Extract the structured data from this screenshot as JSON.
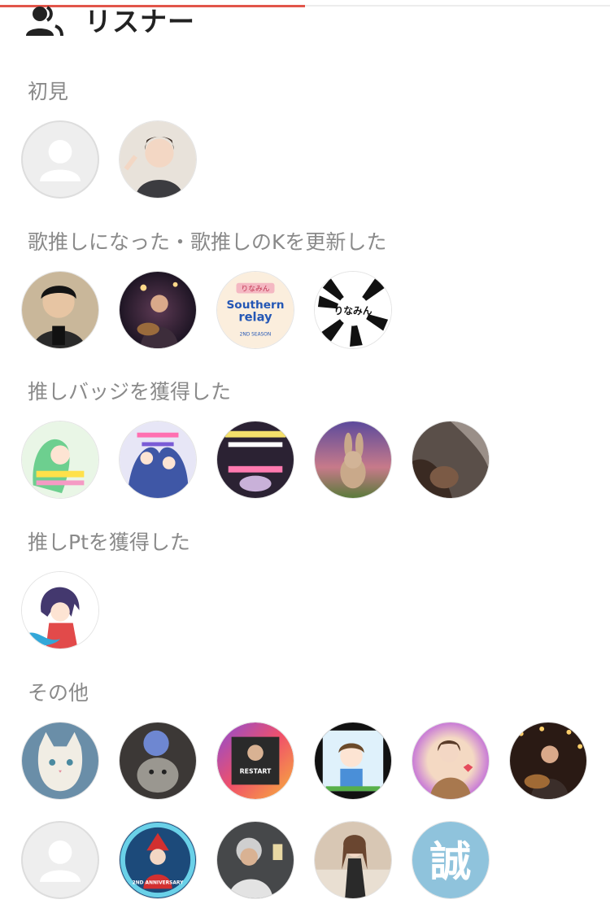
{
  "progress": 0.5,
  "header": {
    "title": "リスナー",
    "icon": "users-icon"
  },
  "sections": [
    {
      "id": "first-view",
      "label": "初見"
    },
    {
      "id": "song-oshi",
      "label": "歌推しになった・歌推しのKを更新した"
    },
    {
      "id": "badge",
      "label": "推しバッジを獲得した"
    },
    {
      "id": "point",
      "label": "推しPtを獲得した"
    },
    {
      "id": "other",
      "label": "その他"
    }
  ],
  "avatars": {
    "first_view": [
      "default-avatar-icon",
      "user-avatar"
    ],
    "song_oshi": [
      "user-avatar",
      "user-avatar",
      "user-avatar",
      "user-avatar"
    ],
    "badge": [
      "user-avatar",
      "user-avatar",
      "user-avatar",
      "user-avatar",
      "user-avatar"
    ],
    "point": [
      "user-avatar"
    ],
    "other": [
      "user-avatar",
      "user-avatar",
      "user-avatar",
      "user-avatar",
      "user-avatar",
      "user-avatar",
      "default-avatar-icon",
      "user-avatar",
      "user-avatar",
      "user-avatar",
      "user-avatar"
    ]
  },
  "badge_texts": {
    "rinamin": "りなみん",
    "southern": "Southern",
    "relay": "relay",
    "season": "2ND SEASON",
    "southern_relay": "SOUTHERN RELAY",
    "kanji": "誠",
    "restart": "RESTART",
    "anniversary": "2ND ANNIVERSARY"
  },
  "colors": {
    "accent": "#e2554a",
    "label": "#8a8a8a",
    "title": "#222222",
    "placeholder_bg": "#eeeeee",
    "placeholder_fg": "#ffffff"
  }
}
